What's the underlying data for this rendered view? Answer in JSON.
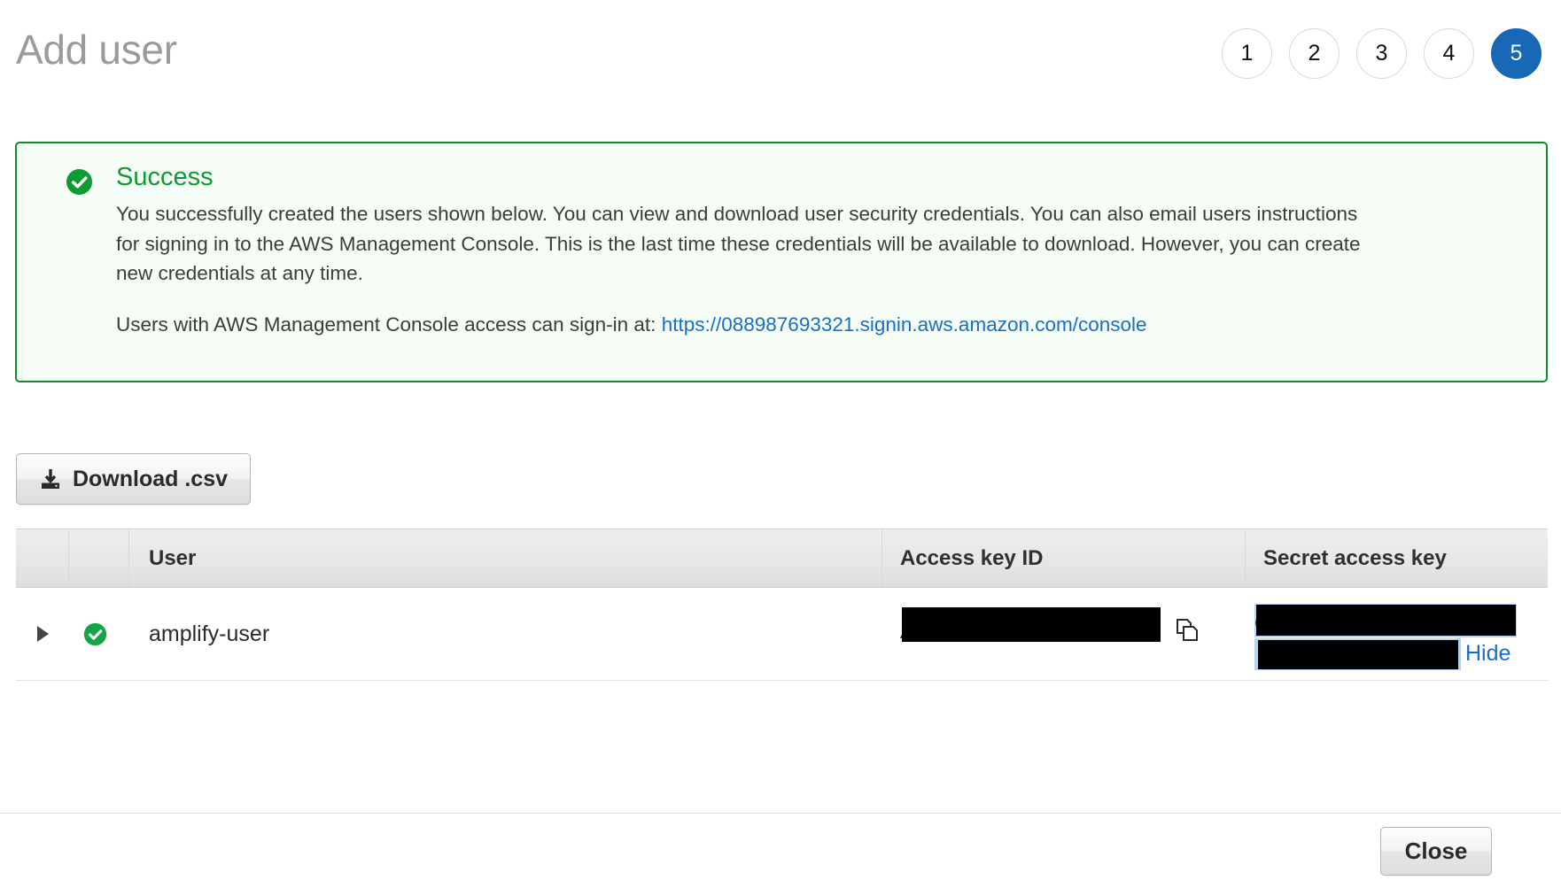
{
  "header": {
    "title": "Add user",
    "steps": [
      {
        "label": "1",
        "active": false
      },
      {
        "label": "2",
        "active": false
      },
      {
        "label": "3",
        "active": false
      },
      {
        "label": "4",
        "active": false
      },
      {
        "label": "5",
        "active": true
      }
    ]
  },
  "banner": {
    "icon": "success-check-icon",
    "title": "Success",
    "paragraph1": "You successfully created the users shown below. You can view and download user security credentials. You can also email users instructions for signing in to the AWS Management Console. This is the last time these credentials will be available to download. However, you can create new credentials at any time.",
    "paragraph2_prefix": "Users with AWS Management Console access can sign-in at: ",
    "signin_url": "https://088987693321.signin.aws.amazon.com/console",
    "border_color": "#0f8a2e",
    "background_color": "#f6fdf6",
    "title_color": "#0f9a34",
    "link_color": "#176fc9"
  },
  "toolbar": {
    "download_label": "Download .csv",
    "download_icon": "download-icon"
  },
  "table": {
    "headers": {
      "expand": "",
      "state": "",
      "user": "User",
      "access_key_id": "Access key ID",
      "secret_access_key": "Secret access key"
    },
    "rows": [
      {
        "expander_icon": "triangle-right-icon",
        "state_icon": "success-check-icon",
        "user": "amplify-user",
        "access_key_id": "A",
        "access_key_id_redacted": true,
        "copy_icon": "copy-icon",
        "secret_access_key": "C",
        "secret_access_key_redacted": true,
        "secret_toggle_label": "Hide"
      }
    ]
  },
  "footer": {
    "close_label": "Close"
  },
  "theme": {
    "accent_blue": "#1769b8",
    "link_blue": "#176fc9",
    "success_green": "#0f9a34",
    "title_gray": "#9b9b9b",
    "selection_blue": "#b6d2f3",
    "redaction_black": "#000000"
  }
}
